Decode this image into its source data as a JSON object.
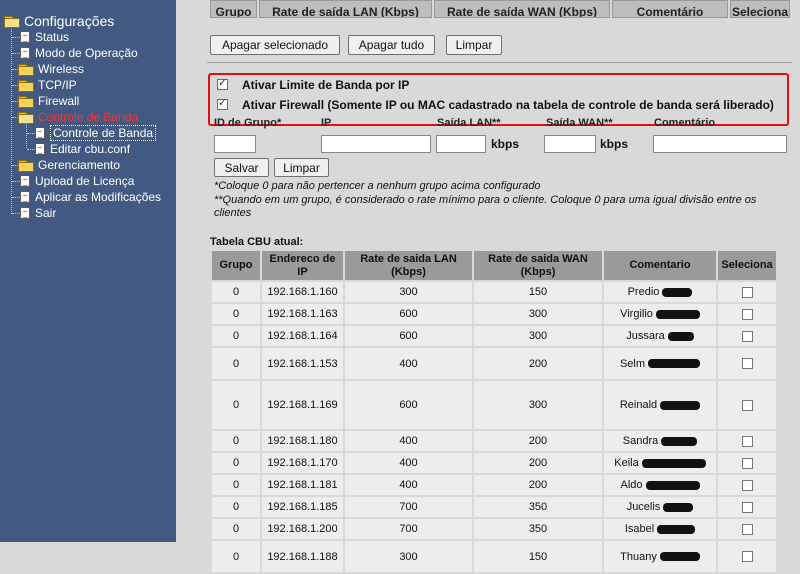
{
  "sidebar": {
    "root": "Configurações",
    "items": [
      {
        "label": "Status",
        "icon": "page"
      },
      {
        "label": "Modo de Operação",
        "icon": "page"
      },
      {
        "label": "Wireless",
        "icon": "folder"
      },
      {
        "label": "TCP/IP",
        "icon": "folder"
      },
      {
        "label": "Firewall",
        "icon": "folder"
      },
      {
        "label": "Controle de Banda",
        "icon": "folder-open",
        "active": true
      },
      {
        "label": "Controle de Banda",
        "icon": "page",
        "selected": true
      },
      {
        "label": "Editar cbu.conf",
        "icon": "page"
      },
      {
        "label": "Gerenciamento",
        "icon": "folder"
      },
      {
        "label": "Upload de Licença",
        "icon": "page"
      },
      {
        "label": "Aplicar as Modificações",
        "icon": "page"
      },
      {
        "label": "Sair",
        "icon": "page"
      }
    ]
  },
  "top_table": {
    "headers": [
      "Grupo",
      "Rate de saída LAN (Kbps)",
      "Rate de saída WAN (Kbps)",
      "Comentário",
      "Seleciona"
    ]
  },
  "actions": {
    "delete_selected": "Apagar selecionado",
    "delete_all": "Apagar tudo",
    "clear": "Limpar"
  },
  "options": {
    "bandwidth_limit_label": "Ativar Limite de Banda por IP",
    "bandwidth_limit_checked": true,
    "firewall_label": "Ativar Firewall (Somente IP ou MAC cadastrado na tabela de controle de banda será liberado)",
    "firewall_checked": true
  },
  "form": {
    "group_id_label": "ID de Grupo*",
    "ip_label": "IP",
    "lan_label": "Saída LAN**",
    "wan_label": "Saída WAN**",
    "comment_label": "Comentário",
    "group_id_value": "",
    "ip_value": "",
    "lan_value": "",
    "wan_value": "",
    "comment_value": "",
    "lan_unit": "kbps",
    "wan_unit": "kbps",
    "save": "Salvar",
    "clear": "Limpar"
  },
  "notes": {
    "note1": "*Coloque 0 para não pertencer a nenhum grupo acima configurado",
    "note2": "**Quando em um grupo, é considerado o rate mínimo para o cliente. Coloque 0 para uma igual divisão entre os clientes"
  },
  "cbu_table": {
    "caption": "Tabela CBU atual:",
    "headers": [
      "Grupo",
      "Endereco de IP",
      "Rate de saida LAN (Kbps)",
      "Rate de saida WAN (Kbps)",
      "Comentario",
      "Seleciona"
    ],
    "rows": [
      {
        "group": "0",
        "ip": "192.168.1.160",
        "lan": "300",
        "wan": "150",
        "comment": "Predio"
      },
      {
        "group": "0",
        "ip": "192.168.1.163",
        "lan": "600",
        "wan": "300",
        "comment": "Virgilio"
      },
      {
        "group": "0",
        "ip": "192.168.1.164",
        "lan": "600",
        "wan": "300",
        "comment": "Jussara"
      },
      {
        "group": "0",
        "ip": "192.168.1.153",
        "lan": "400",
        "wan": "200",
        "comment": "Selm"
      },
      {
        "group": "0",
        "ip": "192.168.1.169",
        "lan": "600",
        "wan": "300",
        "comment": "Reinald"
      },
      {
        "group": "0",
        "ip": "192.168.1.180",
        "lan": "400",
        "wan": "200",
        "comment": "Sandra"
      },
      {
        "group": "0",
        "ip": "192.168.1.170",
        "lan": "400",
        "wan": "200",
        "comment": "Keila"
      },
      {
        "group": "0",
        "ip": "192.168.1.181",
        "lan": "400",
        "wan": "200",
        "comment": "Aldo"
      },
      {
        "group": "0",
        "ip": "192.168.1.185",
        "lan": "700",
        "wan": "350",
        "comment": "Jucelis"
      },
      {
        "group": "0",
        "ip": "192.168.1.200",
        "lan": "700",
        "wan": "350",
        "comment": "Isabel"
      },
      {
        "group": "0",
        "ip": "192.168.1.188",
        "lan": "300",
        "wan": "150",
        "comment": "Thuany"
      }
    ]
  },
  "colors": {
    "sidebar_bg": "#425a82",
    "active_link": "#ff3030",
    "highlight_box": "#e01010",
    "header_cell": "#9a9a9a",
    "data_cell": "#ededed",
    "page_bg": "#d9d9d9"
  }
}
